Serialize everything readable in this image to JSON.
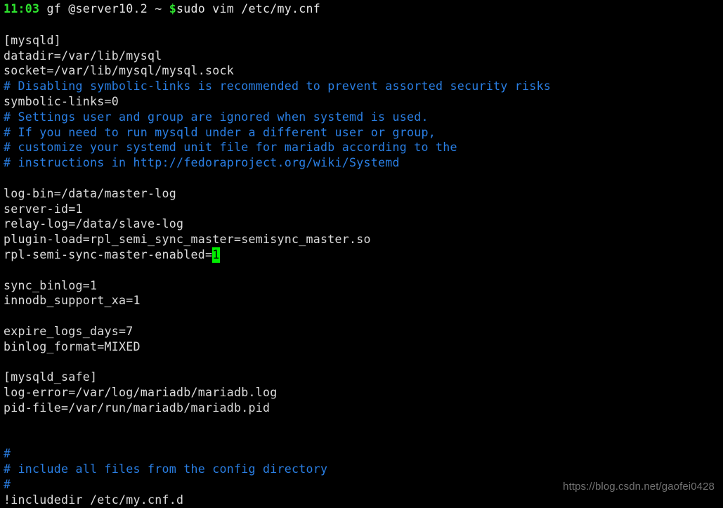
{
  "terminal": {
    "background_color": "#000000",
    "foreground_color": "#dcdcdc",
    "comment_color": "#2a7fe4",
    "accent_green": "#2ee32e",
    "cursor_color": "#00ef00",
    "prompt": {
      "time": "11:03",
      "user_host": " gf @server10.2 ~ ",
      "dollar": "$",
      "command": "sudo vim /etc/my.cnf"
    },
    "file_name": "/etc/my.cnf",
    "lines": [
      {
        "text": "",
        "style": "blank"
      },
      {
        "text": "[mysqld]",
        "style": "plain"
      },
      {
        "text": "datadir=/var/lib/mysql",
        "style": "plain"
      },
      {
        "text": "socket=/var/lib/mysql/mysql.sock",
        "style": "plain"
      },
      {
        "text": "# Disabling symbolic-links is recommended to prevent assorted security risks",
        "style": "comment"
      },
      {
        "text": "symbolic-links=0",
        "style": "plain"
      },
      {
        "text": "# Settings user and group are ignored when systemd is used.",
        "style": "comment"
      },
      {
        "text": "# If you need to run mysqld under a different user or group,",
        "style": "comment"
      },
      {
        "text": "# customize your systemd unit file for mariadb according to the",
        "style": "comment"
      },
      {
        "text": "# instructions in http://fedoraproject.org/wiki/Systemd",
        "style": "comment"
      },
      {
        "text": "",
        "style": "blank"
      },
      {
        "text": "log-bin=/data/master-log",
        "style": "plain"
      },
      {
        "text": "server-id=1",
        "style": "plain"
      },
      {
        "text": "relay-log=/data/slave-log",
        "style": "plain"
      },
      {
        "text": "plugin-load=rpl_semi_sync_master=semisync_master.so",
        "style": "plain"
      },
      {
        "text": "rpl-semi-sync-master-enabled=",
        "style": "plain",
        "cursor": "1"
      },
      {
        "text": "",
        "style": "blank"
      },
      {
        "text": "sync_binlog=1",
        "style": "plain"
      },
      {
        "text": "innodb_support_xa=1",
        "style": "plain"
      },
      {
        "text": "",
        "style": "blank"
      },
      {
        "text": "expire_logs_days=7",
        "style": "plain"
      },
      {
        "text": "binlog_format=MIXED",
        "style": "plain"
      },
      {
        "text": "",
        "style": "blank"
      },
      {
        "text": "[mysqld_safe]",
        "style": "plain"
      },
      {
        "text": "log-error=/var/log/mariadb/mariadb.log",
        "style": "plain"
      },
      {
        "text": "pid-file=/var/run/mariadb/mariadb.pid",
        "style": "plain"
      },
      {
        "text": "",
        "style": "blank"
      },
      {
        "text": "",
        "style": "blank"
      },
      {
        "text": "#",
        "style": "comment"
      },
      {
        "text": "# include all files from the config directory",
        "style": "comment"
      },
      {
        "text": "#",
        "style": "comment"
      },
      {
        "text": "!includedir /etc/my.cnf.d",
        "style": "plain"
      }
    ]
  },
  "watermark": {
    "text": "https://blog.csdn.net/gaofei0428"
  }
}
